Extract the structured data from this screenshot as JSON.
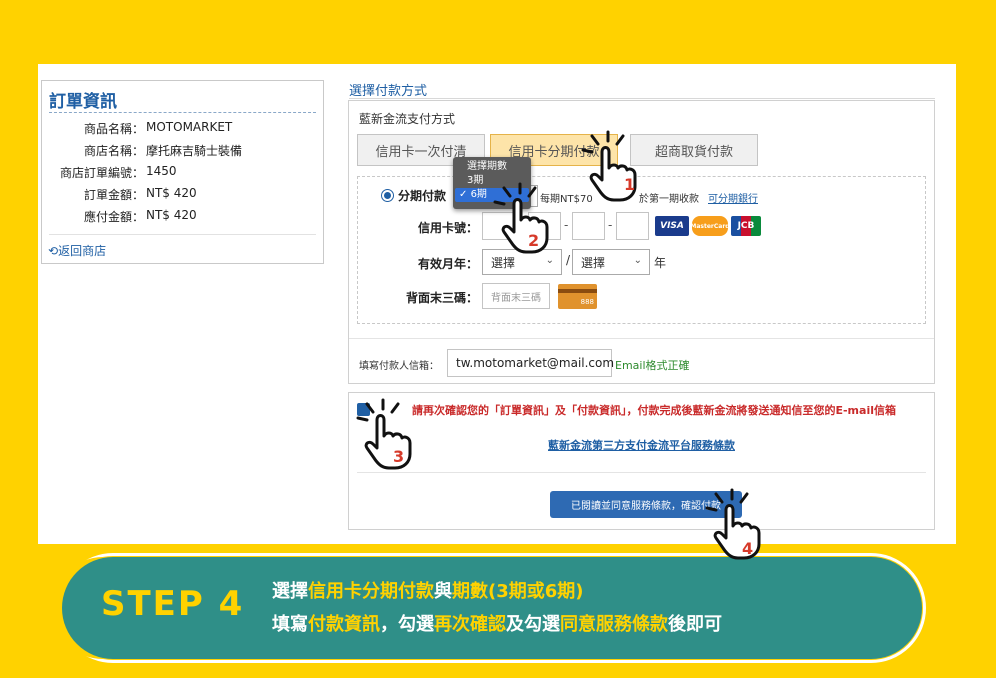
{
  "order": {
    "title": "訂單資訊",
    "rows": [
      {
        "label": "商品名稱：",
        "value": "MOTOMARKET"
      },
      {
        "label": "商店名稱：",
        "value": "摩托麻吉騎士裝備"
      },
      {
        "label": "商店訂單編號：",
        "value": "1450"
      },
      {
        "label": "訂單金額：",
        "value": "NT$ 420"
      },
      {
        "label": "應付金額：",
        "value": "NT$ 420"
      }
    ],
    "back_link": "返回商店"
  },
  "payment": {
    "heading": "選擇付款方式",
    "provider": "藍新金流支付方式",
    "tabs": [
      {
        "label": "信用卡一次付清",
        "active": false
      },
      {
        "label": "信用卡分期付款",
        "active": true
      },
      {
        "label": "超商取貨付款",
        "active": false
      }
    ],
    "installment": {
      "label": "分期付款",
      "selected": "6期",
      "per_period_text": "每期NT$70",
      "first_period_text": "於第一期收款",
      "banks_link": "可分期銀行",
      "dropdown_options": [
        "選擇期數",
        "3期",
        "6期"
      ]
    },
    "card_number_label": "信用卡號：",
    "card_brands": [
      "VISA",
      "MasterCard",
      "JCB"
    ],
    "expiry_label": "有效月年：",
    "month_select": "選擇",
    "year_select": "選擇",
    "year_suffix": "年",
    "cvv_label": "背面末三碼：",
    "cvv_placeholder": "背面末三碼",
    "cvv_card_number": "888",
    "email_label": "填寫付款人信箱：",
    "email_value": "tw.motomarket@mail.com",
    "email_status": "Email格式正確"
  },
  "confirm": {
    "text": "請再次確認您的「訂單資訊」及「付款資訊」，付款完成後藍新金流將發送通知信至您的E-mail信箱",
    "terms_link": "藍新金流第三方支付金流平台服務條款",
    "agree_button": "已閱讀並同意服務條款，確認付款"
  },
  "steps": [
    "1",
    "2",
    "3",
    "4"
  ],
  "banner": {
    "step": "STEP 4",
    "line1": [
      {
        "t": "選擇",
        "hl": false
      },
      {
        "t": "信用卡分期付款",
        "hl": true
      },
      {
        "t": "與",
        "hl": false
      },
      {
        "t": "期數(3期或6期)",
        "hl": true
      }
    ],
    "line2": [
      {
        "t": "填寫",
        "hl": false
      },
      {
        "t": "付款資訊",
        "hl": true
      },
      {
        "t": "，勾選",
        "hl": false
      },
      {
        "t": "再次確認",
        "hl": true
      },
      {
        "t": "及勾選",
        "hl": false
      },
      {
        "t": "同意服務條款",
        "hl": true
      },
      {
        "t": "後即可",
        "hl": false
      }
    ]
  },
  "colors": {
    "background": "#ffd200",
    "banner": "#2f8f88",
    "accent": "#1f5fa4",
    "warning": "#c92a2a"
  }
}
